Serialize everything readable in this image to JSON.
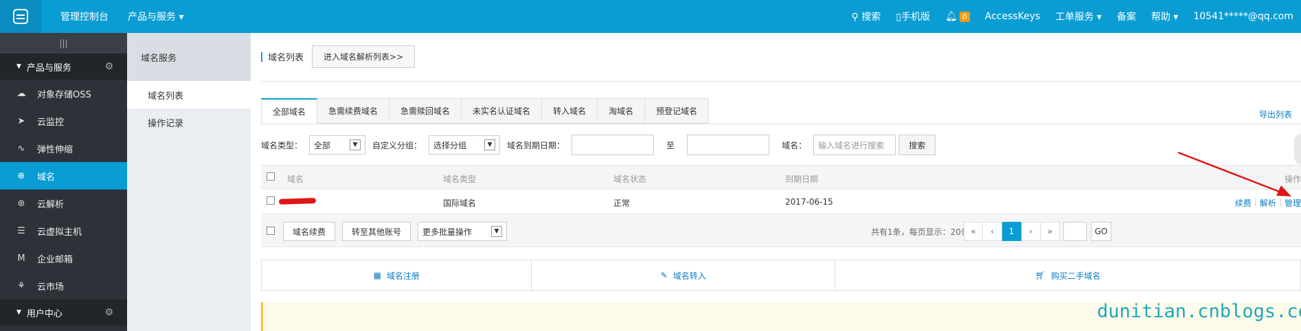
{
  "topbar": {
    "console": "管理控制台",
    "products": "产品与服务",
    "search": "搜索",
    "mobile": "手机版",
    "notif_count": "0",
    "accesskeys": "AccessKeys",
    "tickets": "工单服务",
    "beian": "备案",
    "help": "帮助",
    "user": "10541*****@qq.com"
  },
  "sidebar": {
    "toggle": "|||",
    "section1": "产品与服务",
    "items": [
      {
        "label": "对象存储OSS",
        "icon": "cloud-icon"
      },
      {
        "label": "云监控",
        "icon": "monitor-icon"
      },
      {
        "label": "弹性伸缩",
        "icon": "scaling-icon"
      },
      {
        "label": "域名",
        "icon": "globe-icon"
      },
      {
        "label": "云解析",
        "icon": "dns-icon"
      },
      {
        "label": "云虚拟主机",
        "icon": "server-icon"
      },
      {
        "label": "企业邮箱",
        "icon": "mail-icon"
      },
      {
        "label": "云市场",
        "icon": "market-icon"
      }
    ],
    "section2": "用户中心"
  },
  "subnav": {
    "header": "域名服务",
    "items": [
      "域名列表",
      "操作记录"
    ]
  },
  "main": {
    "title": "域名列表",
    "dns_btn": "进入域名解析列表>>",
    "tabs": [
      "全部域名",
      "急需续费域名",
      "急需赎回域名",
      "未实名认证域名",
      "转入域名",
      "淘域名",
      "预登记域名"
    ],
    "export": "导出列表",
    "filters": {
      "type_label": "域名类型：",
      "type_value": "全部",
      "group_label": "自定义分组：",
      "group_value": "选择分组",
      "expire_label": "域名到期日期：",
      "to": "至",
      "domain_label": "域名：",
      "domain_placeholder": "输入域名进行搜索",
      "search_btn": "搜索"
    },
    "table": {
      "headers": [
        "域名",
        "域名类型",
        "域名状态",
        "到期日期",
        "操作"
      ],
      "row": {
        "type": "国际域名",
        "status": "正常",
        "expire": "2017-06-15",
        "ops": [
          "续费",
          "解析",
          "管理"
        ]
      }
    },
    "footer": {
      "renew_btn": "域名续费",
      "transfer_btn": "转至其他账号",
      "more_ops": "更多批量操作",
      "info": "共有1条，每页显示：20条",
      "pages": [
        "«",
        "‹",
        "1",
        "›",
        "»"
      ],
      "go": "GO"
    },
    "quick": [
      "域名注册",
      "域名转入",
      "购买二手域名"
    ]
  },
  "watermark": "dunitian.cnblogs.com"
}
